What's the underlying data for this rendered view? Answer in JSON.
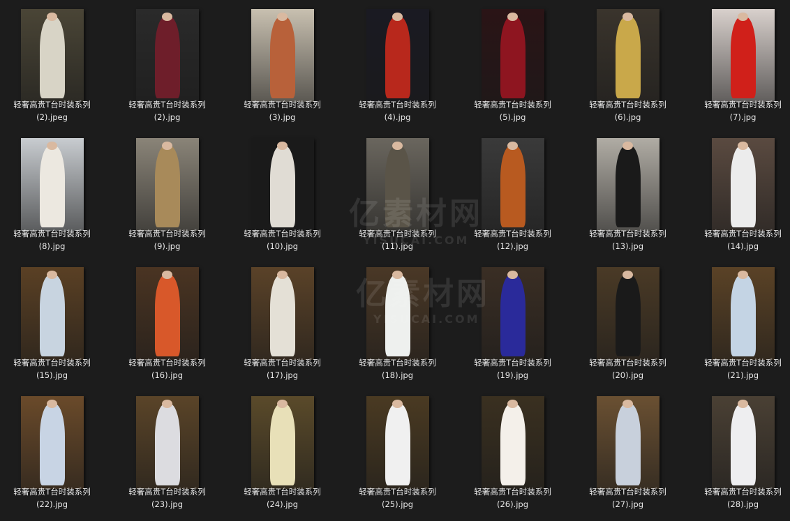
{
  "files": [
    {
      "line1": "轻奢高贵T台时装系列",
      "line2": "(2).jpeg",
      "bg": "#4a4536",
      "fig": "#d8d4c6"
    },
    {
      "line1": "轻奢高贵T台时装系列",
      "line2": "(2).jpg",
      "bg": "#2a2a2a",
      "fig": "#6e1e2a"
    },
    {
      "line1": "轻奢高贵T台时装系列",
      "line2": "(3).jpg",
      "bg": "#c8c0b0",
      "fig": "#b8613a"
    },
    {
      "line1": "轻奢高贵T台时装系列",
      "line2": "(4).jpg",
      "bg": "#1a1a22",
      "fig": "#b8281c"
    },
    {
      "line1": "轻奢高贵T台时装系列",
      "line2": "(5).jpg",
      "bg": "#2a1416",
      "fig": "#8e1520"
    },
    {
      "line1": "轻奢高贵T台时装系列",
      "line2": "(6).jpg",
      "bg": "#3a342c",
      "fig": "#c9a84a"
    },
    {
      "line1": "轻奢高贵T台时装系列",
      "line2": "(7).jpg",
      "bg": "#d8d0cc",
      "fig": "#d0201a"
    },
    {
      "line1": "轻奢高贵T台时装系列",
      "line2": "(8).jpg",
      "bg": "#c8ccd0",
      "fig": "#ece8e0"
    },
    {
      "line1": "轻奢高贵T台时装系列",
      "line2": "(9).jpg",
      "bg": "#8a8478",
      "fig": "#a88a5a"
    },
    {
      "line1": "轻奢高贵T台时装系列",
      "line2": "(10).jpg",
      "bg": "#1a1a1a",
      "fig": "#e0dcd4"
    },
    {
      "line1": "轻奢高贵T台时装系列",
      "line2": "(11).jpg",
      "bg": "#6a665e",
      "fig": "#5a5448"
    },
    {
      "line1": "轻奢高贵T台时装系列",
      "line2": "(12).jpg",
      "bg": "#3a3a3a",
      "fig": "#b85a20"
    },
    {
      "line1": "轻奢高贵T台时装系列",
      "line2": "(13).jpg",
      "bg": "#b0aca4",
      "fig": "#1a1a1a"
    },
    {
      "line1": "轻奢高贵T台时装系列",
      "line2": "(14).jpg",
      "bg": "#5a4a40",
      "fig": "#ececec"
    },
    {
      "line1": "轻奢高贵T台时装系列",
      "line2": "(15).jpg",
      "bg": "#5a4024",
      "fig": "#c8d4e0"
    },
    {
      "line1": "轻奢高贵T台时装系列",
      "line2": "(16).jpg",
      "bg": "#4a3422",
      "fig": "#d8582a"
    },
    {
      "line1": "轻奢高贵T台时装系列",
      "line2": "(17).jpg",
      "bg": "#5a4228",
      "fig": "#e4e0d6"
    },
    {
      "line1": "轻奢高贵T台时装系列",
      "line2": "(18).jpg",
      "bg": "#4a3826",
      "fig": "#eef0ee"
    },
    {
      "line1": "轻奢高贵T台时装系列",
      "line2": "(19).jpg",
      "bg": "#3a2e24",
      "fig": "#2a2a9a"
    },
    {
      "line1": "轻奢高贵T台时装系列",
      "line2": "(20).jpg",
      "bg": "#4a3a26",
      "fig": "#1a1a1a"
    },
    {
      "line1": "轻奢高贵T台时装系列",
      "line2": "(21).jpg",
      "bg": "#5a4226",
      "fig": "#c4d4e4"
    },
    {
      "line1": "轻奢高贵T台时装系列",
      "line2": "(22).jpg",
      "bg": "#6a4a2a",
      "fig": "#c8d4e4"
    },
    {
      "line1": "轻奢高贵T台时装系列",
      "line2": "(23).jpg",
      "bg": "#5a4428",
      "fig": "#dcdce0"
    },
    {
      "line1": "轻奢高贵T台时装系列",
      "line2": "(24).jpg",
      "bg": "#5a4a2a",
      "fig": "#e8e0b8"
    },
    {
      "line1": "轻奢高贵T台时装系列",
      "line2": "(25).jpg",
      "bg": "#4a3a22",
      "fig": "#f0f0f0"
    },
    {
      "line1": "轻奢高贵T台时装系列",
      "line2": "(26).jpg",
      "bg": "#3a3020",
      "fig": "#f4f0ea"
    },
    {
      "line1": "轻奢高贵T台时装系列",
      "line2": "(27).jpg",
      "bg": "#6a5032",
      "fig": "#c8d0dc"
    },
    {
      "line1": "轻奢高贵T台时装系列",
      "line2": "(28).jpg",
      "bg": "#4a4034",
      "fig": "#eeeef0"
    }
  ],
  "watermark": {
    "title": "亿素材网",
    "subtitle": "YISUCAI.COM"
  }
}
